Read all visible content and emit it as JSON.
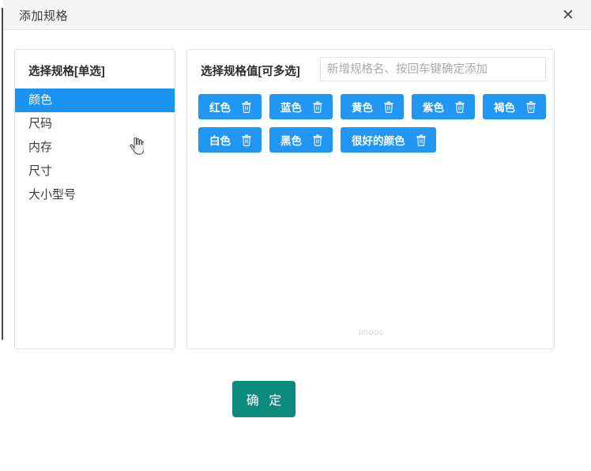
{
  "dialog": {
    "title": "添加规格",
    "close_icon": "close-icon",
    "close_glyph": "✕"
  },
  "left_panel": {
    "title": "选择规格[单选]",
    "items": [
      {
        "label": "颜色",
        "selected": true
      },
      {
        "label": "尺码",
        "selected": false
      },
      {
        "label": "内存",
        "selected": false
      },
      {
        "label": "尺寸",
        "selected": false
      },
      {
        "label": "大小型号",
        "selected": false
      }
    ]
  },
  "right_panel": {
    "title": "选择规格值[可多选]",
    "input": {
      "value": "",
      "placeholder": "新增规格名、按回车键确定添加"
    },
    "tags": [
      {
        "label": "红色",
        "delete_icon": "trash-icon"
      },
      {
        "label": "蓝色",
        "delete_icon": "trash-icon"
      },
      {
        "label": "黄色",
        "delete_icon": "trash-icon"
      },
      {
        "label": "紫色",
        "delete_icon": "trash-icon"
      },
      {
        "label": "褐色",
        "delete_icon": "trash-icon"
      },
      {
        "label": "白色",
        "delete_icon": "trash-icon"
      },
      {
        "label": "黑色",
        "delete_icon": "trash-icon"
      },
      {
        "label": "很好的颜色",
        "delete_icon": "trash-icon"
      }
    ],
    "watermark": "imooc"
  },
  "footer": {
    "confirm_label": "确 定"
  },
  "colors": {
    "accent_blue": "#2196f3",
    "selected_blue": "#1c93f0",
    "confirm_green": "#0c8a7d",
    "header_bg": "#f5f5f5",
    "panel_border": "#e4e4e4"
  }
}
